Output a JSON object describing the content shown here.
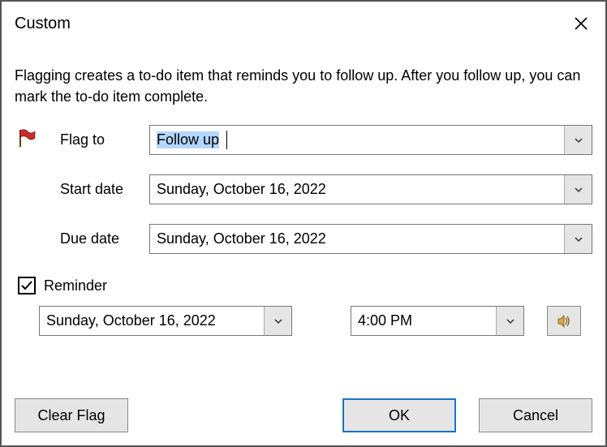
{
  "title": "Custom",
  "description": "Flagging creates a to-do item that reminds you to follow up. After you follow up, you can mark the to-do item complete.",
  "fields": {
    "flag_to_label": "Flag to",
    "flag_to_value": "Follow up",
    "start_date_label": "Start date",
    "start_date_value": "Sunday, October 16, 2022",
    "due_date_label": "Due date",
    "due_date_value": "Sunday, October 16, 2022"
  },
  "reminder": {
    "label": "Reminder",
    "checked": true,
    "date": "Sunday, October 16, 2022",
    "time": "4:00 PM"
  },
  "buttons": {
    "clear_flag": "Clear Flag",
    "ok": "OK",
    "cancel": "Cancel"
  }
}
